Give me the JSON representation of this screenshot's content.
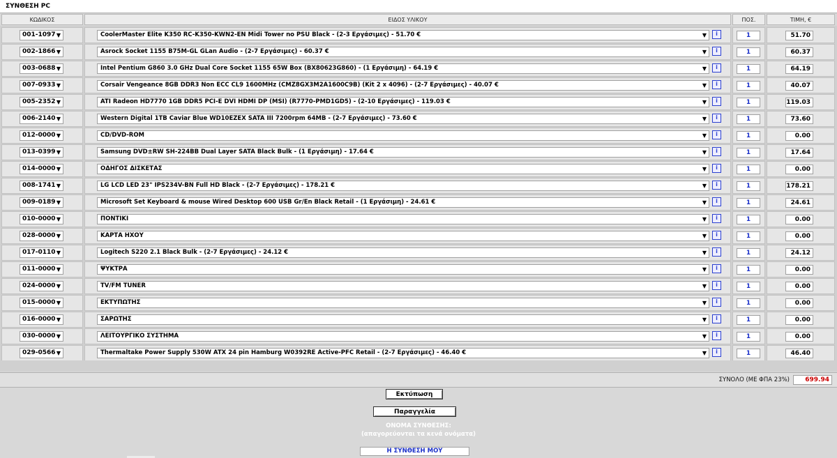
{
  "title": "ΣΥΝΘΕΣΗ PC",
  "headers": {
    "code": "ΚΩΔΙΚΟΣ",
    "item": "ΕΙΔΟΣ ΥΛΙΚΟΥ",
    "qty": "ΠΟΣ.",
    "price": "ΤΙΜΗ, €"
  },
  "info_label": "i",
  "rows": [
    {
      "code": "001-1097",
      "desc": "CoolerMaster Elite K350 RC-K350-KWN2-EN Midi Tower no PSU Black - (2-3 Εργάσιμες) - 51.70 €",
      "qty": "1",
      "price": "51.70"
    },
    {
      "code": "002-1866",
      "desc": "Asrock Socket 1155 B75M-GL GLan Audio - (2-7 Εργάσιμες) - 60.37 €",
      "qty": "1",
      "price": "60.37"
    },
    {
      "code": "003-0688",
      "desc": "Intel Pentium G860 3.0 GHz Dual Core Socket 1155 65W Box (BX80623G860) - (1 Εργάσιμη) - 64.19 €",
      "qty": "1",
      "price": "64.19"
    },
    {
      "code": "007-0933",
      "desc": "Corsair Vengeance 8GB DDR3 Non ECC CL9 1600MHz (CMZ8GX3M2A1600C9B) (Kit 2 x 4096) - (2-7 Εργάσιμες) - 40.07 €",
      "qty": "1",
      "price": "40.07"
    },
    {
      "code": "005-2352",
      "desc": "ATI Radeon HD7770 1GB DDR5 PCI-E DVI HDMI DP (MSI) (R7770-PMD1GD5) - (2-10 Εργάσιμες) - 119.03 €",
      "qty": "1",
      "price": "119.03"
    },
    {
      "code": "006-2140",
      "desc": "Western Digital 1TB Caviar Blue WD10EZEX SATA III 7200rpm 64MB - (2-7 Εργάσιμες) - 73.60 €",
      "qty": "1",
      "price": "73.60"
    },
    {
      "code": "012-0000",
      "desc": "CD/DVD-ROM",
      "qty": "1",
      "price": "0.00"
    },
    {
      "code": "013-0399",
      "desc": "Samsung DVD±RW SH-224BB Dual Layer SATA Black Bulk - (1 Εργάσιμη) - 17.64 €",
      "qty": "1",
      "price": "17.64"
    },
    {
      "code": "014-0000",
      "desc": "ΟΔΗΓΟΣ ΔΙΣΚΕΤΑΣ",
      "qty": "1",
      "price": "0.00"
    },
    {
      "code": "008-1741",
      "desc": "LG LCD LED 23\" IPS234V-BN Full HD Black - (2-7 Εργάσιμες) - 178.21 €",
      "qty": "1",
      "price": "178.21"
    },
    {
      "code": "009-0189",
      "desc": "Microsoft Set Keyboard & mouse Wired Desktop 600 USB Gr/En Black Retail - (1 Εργάσιμη) - 24.61 €",
      "qty": "1",
      "price": "24.61"
    },
    {
      "code": "010-0000",
      "desc": "ΠΟΝΤΙΚΙ",
      "qty": "1",
      "price": "0.00"
    },
    {
      "code": "028-0000",
      "desc": "ΚΑΡΤΑ ΗΧΟΥ",
      "qty": "1",
      "price": "0.00"
    },
    {
      "code": "017-0110",
      "desc": "Logitech S220 2.1 Black Bulk - (2-7 Εργάσιμες) - 24.12 €",
      "qty": "1",
      "price": "24.12"
    },
    {
      "code": "011-0000",
      "desc": "ΨΥΚΤΡΑ",
      "qty": "1",
      "price": "0.00"
    },
    {
      "code": "024-0000",
      "desc": "TV/FM TUNER",
      "qty": "1",
      "price": "0.00"
    },
    {
      "code": "015-0000",
      "desc": "ΕΚΤΥΠΩΤΗΣ",
      "qty": "1",
      "price": "0.00"
    },
    {
      "code": "016-0000",
      "desc": "ΣΑΡΩΤΗΣ",
      "qty": "1",
      "price": "0.00"
    },
    {
      "code": "030-0000",
      "desc": "ΛΕΙΤΟΥΡΓΙΚΟ ΣΥΣΤΗΜΑ",
      "qty": "1",
      "price": "0.00"
    },
    {
      "code": "029-0566",
      "desc": "Thermaltake Power Supply 530W ATX 24 pin Hamburg W0392RE Active-PFC Retail - (2-7 Εργάσιμες) - 46.40 €",
      "qty": "1",
      "price": "46.40"
    }
  ],
  "total": {
    "label": "ΣΥΝΟΛΟ (ΜΕ ΦΠΑ 23%)",
    "value": "699.94",
    "color": "#cc0000"
  },
  "buttons": {
    "print": "Εκτύπωση",
    "order": "Παραγγελία"
  },
  "name_section": {
    "label": "ΟΝΟΜΑ ΣΥΝΘΕΣΗΣ:",
    "note": "(απαγορεύονται τα κενά ονόματα)",
    "value": "Η ΣΥΝΘΕΣΗ ΜΟΥ"
  }
}
